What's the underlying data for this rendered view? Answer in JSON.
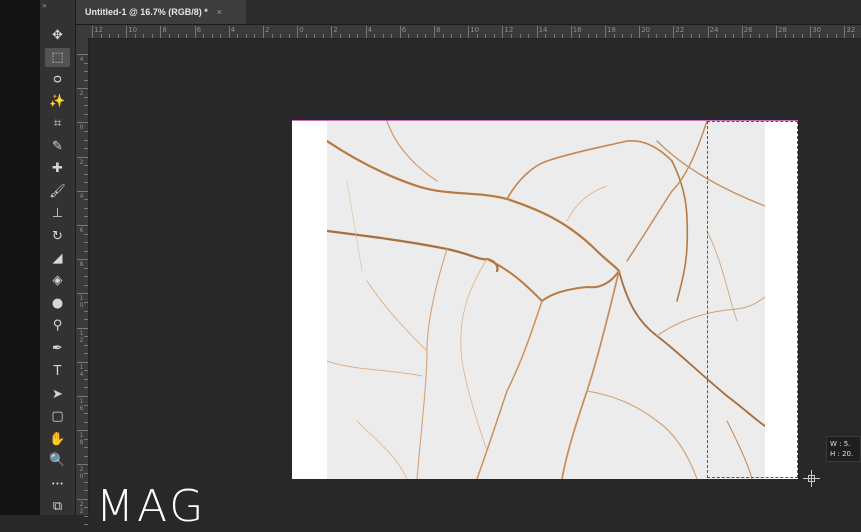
{
  "document_tab": {
    "title": "Untitled-1 @ 16.7% (RGB/8) *",
    "close": "×"
  },
  "toolbar": {
    "collapse": "»",
    "tools": [
      {
        "name": "move-tool",
        "icon": "move-icon",
        "glyph": "✥"
      },
      {
        "name": "marquee-tool",
        "icon": "rectangular-marquee-icon",
        "glyph": "⬚",
        "active": true
      },
      {
        "name": "lasso-tool",
        "icon": "lasso-icon",
        "glyph": "ᴑ"
      },
      {
        "name": "magic-wand-tool",
        "icon": "magic-wand-icon",
        "glyph": "✨"
      },
      {
        "name": "crop-tool",
        "icon": "crop-icon",
        "glyph": "⌗"
      },
      {
        "name": "eyedropper-tool",
        "icon": "eyedropper-icon",
        "glyph": "✎"
      },
      {
        "name": "healing-brush-tool",
        "icon": "bandage-icon",
        "glyph": "✚"
      },
      {
        "name": "brush-tool",
        "icon": "brush-icon",
        "glyph": "🖌"
      },
      {
        "name": "clone-stamp-tool",
        "icon": "stamp-icon",
        "glyph": "⊥"
      },
      {
        "name": "history-brush-tool",
        "icon": "history-brush-icon",
        "glyph": "↻"
      },
      {
        "name": "eraser-tool",
        "icon": "eraser-icon",
        "glyph": "◢"
      },
      {
        "name": "paint-bucket-tool",
        "icon": "paint-bucket-icon",
        "glyph": "◈"
      },
      {
        "name": "blur-tool",
        "icon": "blur-drop-icon",
        "glyph": "●"
      },
      {
        "name": "dodge-tool",
        "icon": "dodge-icon",
        "glyph": "⚲"
      },
      {
        "name": "pen-tool",
        "icon": "pen-icon",
        "glyph": "✒"
      },
      {
        "name": "type-tool",
        "icon": "type-icon",
        "glyph": "T"
      },
      {
        "name": "path-selection-tool",
        "icon": "arrow-pointer-icon",
        "glyph": "➤"
      },
      {
        "name": "rectangle-tool",
        "icon": "rectangle-shape-icon",
        "glyph": "▢"
      },
      {
        "name": "hand-tool",
        "icon": "hand-icon",
        "glyph": "✋"
      },
      {
        "name": "zoom-tool",
        "icon": "magnifier-icon",
        "glyph": "🔍"
      },
      {
        "name": "more-tools",
        "icon": "ellipsis-icon",
        "glyph": "•••"
      },
      {
        "name": "color-swatches",
        "icon": "swap-colors-icon",
        "glyph": "⧉"
      }
    ]
  },
  "hruler": {
    "labels": [
      "12",
      "10",
      "8",
      "6",
      "4",
      "2",
      "0",
      "2",
      "4",
      "6",
      "8",
      "10",
      "12",
      "14",
      "16",
      "18",
      "20",
      "22",
      "24",
      "26",
      "28",
      "30",
      "32"
    ]
  },
  "vruler": {
    "labels": [
      "4",
      "2",
      "0",
      "2",
      "4",
      "6",
      "8",
      "1\n0",
      "1\n2",
      "1\n4",
      "1\n6",
      "1\n8",
      "2\n0",
      "2\n2"
    ]
  },
  "transform_tooltip": {
    "w": "W :   5.",
    "h": "H :  20."
  },
  "watermark": "MAG",
  "colors": {
    "canvas_bg": "#282828",
    "document": "#ffffff",
    "marble": "#ededed",
    "vein": "#c8874f",
    "artboard_edge": "#c66fbf"
  }
}
